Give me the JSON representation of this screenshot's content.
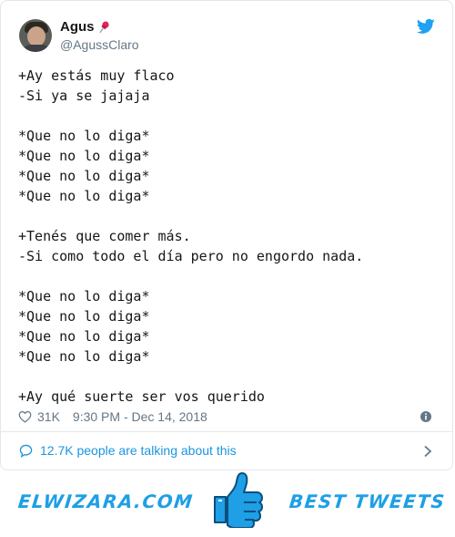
{
  "tweet": {
    "author_name": "Agus",
    "author_handle": "@AgussClaro",
    "text": "+Ay estás muy flaco\n-Si ya se jajaja\n\n*Que no lo diga*\n*Que no lo diga*\n*Que no lo diga*\n*Que no lo diga*\n\n+Tenés que comer más.\n-Si como todo el día pero no engordo nada.\n\n*Que no lo diga*\n*Que no lo diga*\n*Que no lo diga*\n*Que no lo diga*\n\n+Ay qué suerte ser vos querido",
    "likes": "31K",
    "timestamp": "9:30 PM - Dec 14, 2018"
  },
  "conversation": {
    "label": "12.7K people are talking about this"
  },
  "banner": {
    "left_text": "ELWIZARA.COM",
    "right_text": "BEST TWEETS"
  },
  "icons": {
    "brand": "twitter-bird-icon",
    "like": "heart-icon",
    "info": "info-icon",
    "conversation": "speech-bubble-icon",
    "chevron": "chevron-right-icon",
    "thumbs": "thumbs-up-icon",
    "name_emoji": "pushpin-icon"
  },
  "colors": {
    "twitter_blue": "#1da1f2",
    "link_blue": "#1b95e0",
    "muted_gray": "#657786",
    "banner_blue": "#1e9fe6"
  }
}
